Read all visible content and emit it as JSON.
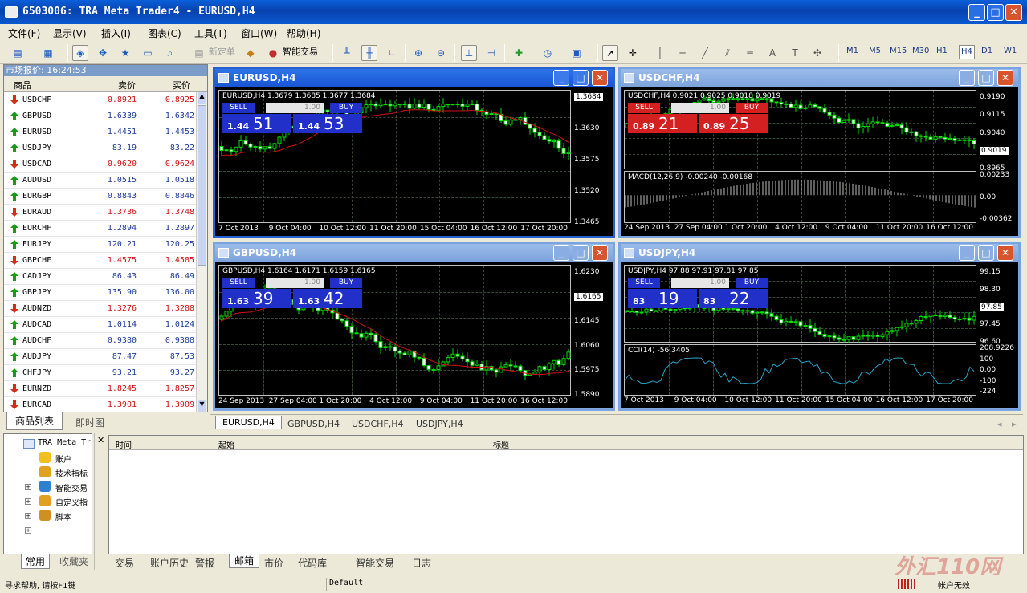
{
  "app": {
    "title": "6503006: TRA Meta Trader4 - EURUSD,H4"
  },
  "menu": [
    "文件(F)",
    "显示(V)",
    "插入(I)",
    "图表(C)",
    "工具(T)",
    "窗口(W)",
    "帮助(H)"
  ],
  "toolbar": {
    "new_order": "新定单",
    "auto_trading": "智能交易",
    "timeframes": [
      "M1",
      "M5",
      "M15",
      "M30",
      "H1",
      "H4",
      "D1",
      "W1"
    ],
    "active_tf": "H4"
  },
  "market_watch": {
    "header": "市场报价: 16:24:53",
    "col_symbol": "商品",
    "col_bid": "卖价",
    "col_ask": "买价",
    "rows": [
      {
        "s": "USDCHF",
        "b": "0.8921",
        "a": "0.8925",
        "d": "down"
      },
      {
        "s": "GBPUSD",
        "b": "1.6339",
        "a": "1.6342",
        "d": "up"
      },
      {
        "s": "EURUSD",
        "b": "1.4451",
        "a": "1.4453",
        "d": "up"
      },
      {
        "s": "USDJPY",
        "b": "83.19",
        "a": "83.22",
        "d": "up"
      },
      {
        "s": "USDCAD",
        "b": "0.9620",
        "a": "0.9624",
        "d": "down"
      },
      {
        "s": "AUDUSD",
        "b": "1.0515",
        "a": "1.0518",
        "d": "up"
      },
      {
        "s": "EURGBP",
        "b": "0.8843",
        "a": "0.8846",
        "d": "up"
      },
      {
        "s": "EURAUD",
        "b": "1.3736",
        "a": "1.3748",
        "d": "down"
      },
      {
        "s": "EURCHF",
        "b": "1.2894",
        "a": "1.2897",
        "d": "up"
      },
      {
        "s": "EURJPY",
        "b": "120.21",
        "a": "120.25",
        "d": "up"
      },
      {
        "s": "GBPCHF",
        "b": "1.4575",
        "a": "1.4585",
        "d": "down"
      },
      {
        "s": "CADJPY",
        "b": "86.43",
        "a": "86.49",
        "d": "up"
      },
      {
        "s": "GBPJPY",
        "b": "135.90",
        "a": "136.00",
        "d": "up"
      },
      {
        "s": "AUDNZD",
        "b": "1.3276",
        "a": "1.3288",
        "d": "down"
      },
      {
        "s": "AUDCAD",
        "b": "1.0114",
        "a": "1.0124",
        "d": "up"
      },
      {
        "s": "AUDCHF",
        "b": "0.9380",
        "a": "0.9388",
        "d": "up"
      },
      {
        "s": "AUDJPY",
        "b": "87.47",
        "a": "87.53",
        "d": "up"
      },
      {
        "s": "CHFJPY",
        "b": "93.21",
        "a": "93.27",
        "d": "up"
      },
      {
        "s": "EURNZD",
        "b": "1.8245",
        "a": "1.8257",
        "d": "down"
      },
      {
        "s": "EURCAD",
        "b": "1.3901",
        "a": "1.3909",
        "d": "down"
      }
    ],
    "tabs": [
      "商品列表",
      "即时图"
    ]
  },
  "charts": [
    {
      "title": "EURUSD,H4",
      "ohlc": "EURUSD,H4  1.3679 1.3685 1.3677 1.3684",
      "sell_small": "1.44",
      "sell_big": "51",
      "buy_small": "1.44",
      "buy_big": "53",
      "prices": [
        "1.3684",
        "1.3630",
        "1.3575",
        "1.3520",
        "1.3465"
      ],
      "dates": [
        "7 Oct 2013",
        "9 Oct 04:00",
        "10 Oct 12:00",
        "11 Oct 20:00",
        "15 Oct 04:00",
        "16 Oct 12:00",
        "17 Oct 20:00"
      ],
      "red": false
    },
    {
      "title": "USDCHF,H4",
      "ohlc": "USDCHF,H4  0.9021 0.9025 0.9018 0.9019",
      "sell_small": "0.89",
      "sell_big": "21",
      "buy_small": "0.89",
      "buy_big": "25",
      "prices": [
        "0.9190",
        "0.9115",
        "0.9040",
        "0.9019",
        "0.8965"
      ],
      "macd": "MACD(12,26,9) -0.00240 -0.00168",
      "macd_prices": [
        "0.00233",
        "0.00",
        "-0.00362"
      ],
      "dates": [
        "24 Sep 2013",
        "27 Sep 04:00",
        "1 Oct 20:00",
        "4 Oct 12:00",
        "9 Oct 04:00",
        "11 Oct 20:00",
        "16 Oct 12:00"
      ],
      "red": true
    },
    {
      "title": "GBPUSD,H4",
      "ohlc": "GBPUSD,H4  1.6164 1.6171 1.6159 1.6165",
      "sell_small": "1.63",
      "sell_big": "39",
      "buy_small": "1.63",
      "buy_big": "42",
      "prices": [
        "1.6230",
        "1.6165",
        "1.6145",
        "1.6060",
        "1.5975",
        "1.5890"
      ],
      "dates": [
        "24 Sep 2013",
        "27 Sep 04:00",
        "1 Oct 20:00",
        "4 Oct 12:00",
        "9 Oct 04:00",
        "11 Oct 20:00",
        "16 Oct 12:00"
      ],
      "red": false
    },
    {
      "title": "USDJPY,H4",
      "ohlc": "USDJPY,H4  97.88 97.91 97.81 97.85",
      "sell_small": "83",
      "sell_big": "19",
      "buy_small": "83",
      "buy_big": "22",
      "prices": [
        "99.15",
        "98.30",
        "97.85",
        "97.45",
        "96.60"
      ],
      "cci": "CCI(14) -56.3405",
      "cci_prices": [
        "208.9226",
        "100",
        "0.00",
        "-100",
        "-224"
      ],
      "dates": [
        "7 Oct 2013",
        "9 Oct 04:00",
        "10 Oct 12:00",
        "11 Oct 20:00",
        "15 Oct 04:00",
        "16 Oct 12:00",
        "17 Oct 20:00"
      ],
      "red": false
    }
  ],
  "chart_labels": {
    "sell": "SELL",
    "buy": "BUY",
    "lot": "1.00"
  },
  "chart_tabs": [
    "EURUSD,H4",
    "GBPUSD,H4",
    "USDCHF,H4",
    "USDJPY,H4"
  ],
  "navigator": {
    "root": "TRA Meta Tr",
    "items": [
      "账户",
      "技术指标",
      "智能交易",
      "自定义指",
      "脚本"
    ],
    "tabs": [
      "常用",
      "收藏夹"
    ]
  },
  "terminal": {
    "col_time": "时间",
    "col_source": "起始",
    "col_title": "标题",
    "tabs": [
      "交易",
      "账户历史",
      "警报",
      "邮箱",
      "市价",
      "代码库",
      "智能交易",
      "日志"
    ],
    "active": "邮箱"
  },
  "status": {
    "help": "寻求帮助, 请按F1键",
    "profile": "Default",
    "account": "帐户无效"
  },
  "watermark": "外汇110网"
}
